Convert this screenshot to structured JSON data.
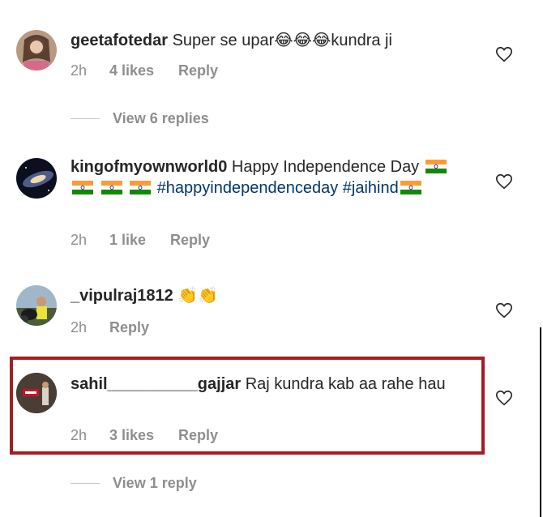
{
  "comments": [
    {
      "username": "geetafotedar",
      "text": "Super se upar",
      "emoji": "😂😂😂",
      "text_after": "kundra ji",
      "time": "2h",
      "likes": "4 likes",
      "reply": "Reply",
      "view_replies": "View 6 replies"
    },
    {
      "username": "kingofmyownworld0",
      "text": "Happy Independence Day",
      "hashtag1": "#happyindependenceday",
      "hashtag2": "#jaihind",
      "time": "2h",
      "likes": "1 like",
      "reply": "Reply"
    },
    {
      "username": "_vipulraj1812",
      "emoji": "👏👏",
      "time": "2h",
      "reply": "Reply"
    },
    {
      "username": "sahil__________gajjar",
      "text": "Raj kundra kab aa rahe hau",
      "time": "2h",
      "likes": "3 likes",
      "reply": "Reply",
      "view_replies": "View 1 reply"
    }
  ],
  "icons": {
    "heart": "heart-icon",
    "flag": "india-flag-icon"
  },
  "colors": {
    "highlight": "#a31d22",
    "hashtag": "#00376b",
    "muted": "#8e8e8e"
  }
}
